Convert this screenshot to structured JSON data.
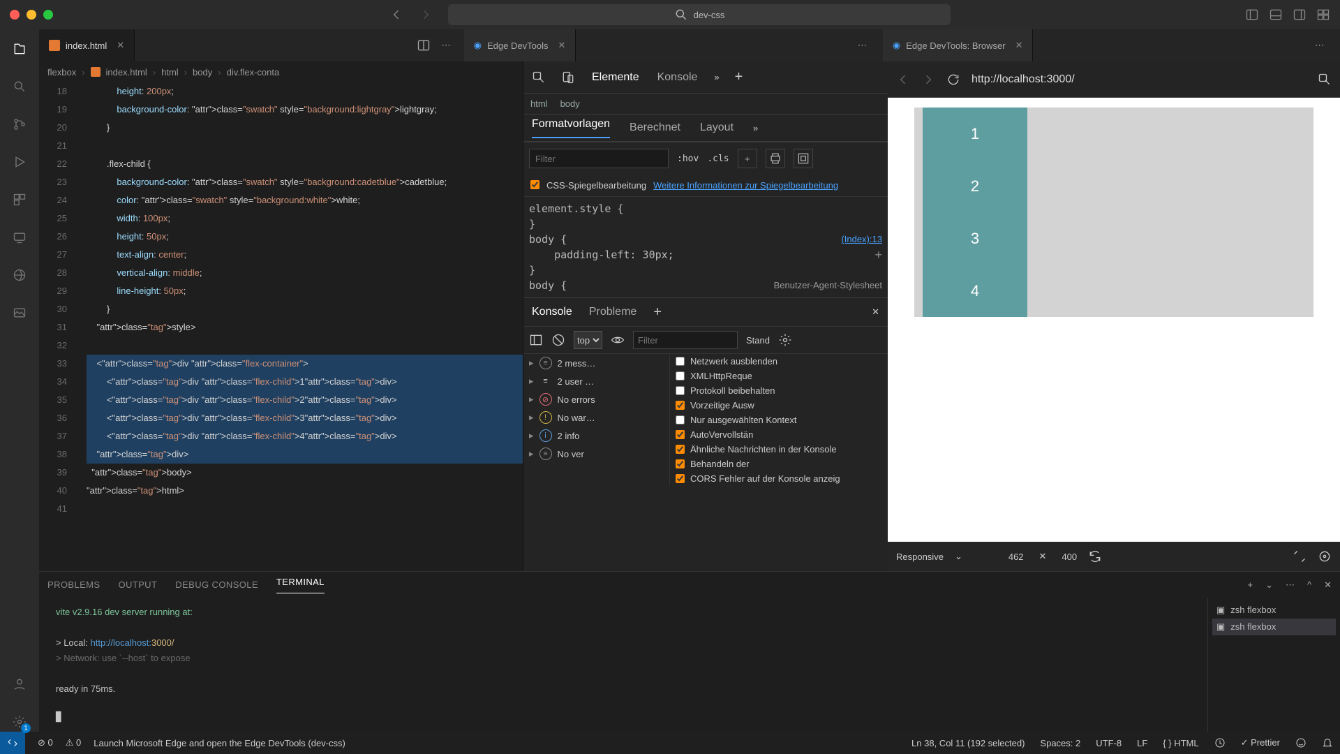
{
  "title_search": "dev-css",
  "activity_badge": "1",
  "tabs": {
    "editor": "index.html",
    "devtools": "Edge DevTools",
    "browser": "Edge DevTools: Browser"
  },
  "breadcrumb": [
    "flexbox",
    "index.html",
    "html",
    "body",
    "div.flex-conta"
  ],
  "editor": {
    "first_line_no": 18,
    "lines": [
      "            height: 200px;",
      "            background-color: ⬛lightgray;",
      "        }",
      "",
      "        .flex-child {",
      "            background-color: ⬛cadetblue;",
      "            color: ⬛white;",
      "            width: 100px;",
      "            height: 50px;",
      "            text-align: center;",
      "            vertical-align: middle;",
      "            line-height: 50px;",
      "        }",
      "    </style>",
      "",
      "    <div class=\"flex-container\">",
      "        <div class=\"flex-child\">1</div>",
      "        <div class=\"flex-child\">2</div>",
      "        <div class=\"flex-child\">3</div>",
      "        <div class=\"flex-child\">4</div>",
      "    </div>",
      "  </body>",
      "</html>",
      ""
    ]
  },
  "devtools": {
    "tabs": [
      "Elemente",
      "Konsole"
    ],
    "crumbs": [
      "html",
      "body"
    ],
    "subtabs": [
      "Formatvorlagen",
      "Berechnet",
      "Layout"
    ],
    "filter_placeholder": "Filter",
    "hov": ":hov",
    "cls": ".cls",
    "mirror_checkbox": "CSS-Spiegelbearbeitung",
    "mirror_link": "Weitere Informationen zur Spiegelbearbeitung",
    "css_block": "element.style {\n}\nbody {\n    padding-left: 30px;\n}\nbody {",
    "css_link": "(Index):13",
    "ua_label": "Benutzer-Agent-Stylesheet",
    "console_tabs": [
      "Konsole",
      "Probleme"
    ],
    "context": "top",
    "console_filter_placeholder": "Filter",
    "levels": "Stand",
    "left_rows": [
      {
        "icon": "msg",
        "label": "2 mess…"
      },
      {
        "icon": "user",
        "label": "2 user …"
      },
      {
        "icon": "red",
        "label": "No errors"
      },
      {
        "icon": "yel",
        "label": "No war…"
      },
      {
        "icon": "blue",
        "label": "2 info"
      },
      {
        "icon": "msg",
        "label": "No ver"
      }
    ],
    "right_opts": [
      {
        "checked": false,
        "label": "Netzwerk ausblenden"
      },
      {
        "checked": false,
        "label": "XMLHttpReque"
      },
      {
        "checked": false,
        "label": "Protokoll beibehalten"
      },
      {
        "checked": true,
        "label": "Vorzeitige Ausw"
      },
      {
        "checked": false,
        "label": "Nur ausgewählten Kontext"
      },
      {
        "checked": true,
        "label": "AutoVervollstän"
      },
      {
        "checked": true,
        "label": "Ähnliche Nachrichten in der Konsole"
      },
      {
        "checked": true,
        "label": "Behandeln der"
      },
      {
        "checked": true,
        "label": "CORS Fehler auf der Konsole anzeig"
      }
    ]
  },
  "browser": {
    "url": "http://localhost:3000/",
    "children": [
      "1",
      "2",
      "3",
      "4"
    ],
    "footer": {
      "mode": "Responsive",
      "w": "462",
      "h": "400"
    }
  },
  "panel": {
    "tabs": [
      "PROBLEMS",
      "OUTPUT",
      "DEBUG CONSOLE",
      "TERMINAL"
    ],
    "terminal_lines": [
      {
        "cls": "g",
        "text": "vite v2.9.16 dev server running at:"
      },
      {
        "cls": "",
        "text": ""
      },
      {
        "cls": "",
        "text": "> Local:  http://localhost:3000/"
      },
      {
        "cls": "dim",
        "text": "> Network:  use `--host` to expose"
      },
      {
        "cls": "",
        "text": ""
      },
      {
        "cls": "",
        "text": "ready in 75ms."
      }
    ],
    "term_sessions": [
      {
        "label": "zsh flexbox",
        "active": false
      },
      {
        "label": "zsh flexbox",
        "active": true
      }
    ]
  },
  "status": {
    "errors": "0",
    "warnings": "0",
    "launch": "Launch Microsoft Edge and open the Edge DevTools (dev-css)",
    "position": "Ln 38, Col 11 (192 selected)",
    "spaces": "Spaces: 2",
    "enc": "UTF-8",
    "eol": "LF",
    "lang": "HTML",
    "prettier": "Prettier"
  }
}
